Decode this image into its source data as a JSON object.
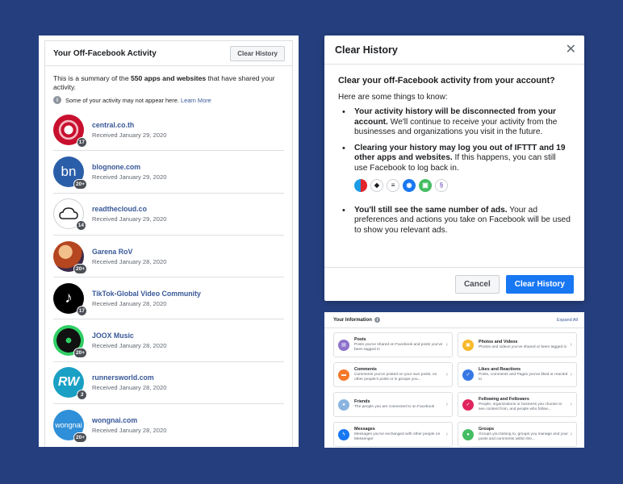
{
  "off_facebook": {
    "title": "Your Off-Facebook Activity",
    "clear_button": "Clear History",
    "summary_prefix": "This is a summary of the ",
    "summary_bold": "550 apps and websites",
    "summary_suffix": " that have shared your activity.",
    "note": "Some of your activity may not appear here.",
    "learn_more": "Learn More",
    "apps": [
      {
        "name": "central.co.th",
        "date": "Received January 29, 2020",
        "badge": "17",
        "icon": "central-logo-icon",
        "color": "#c8102e"
      },
      {
        "name": "blognone.com",
        "date": "Received January 29, 2020",
        "badge": "20+",
        "icon": "blognone-logo-icon",
        "color": "#2a5ea8"
      },
      {
        "name": "readthecloud.co",
        "date": "Received January 29, 2020",
        "badge": "14",
        "icon": "cloud-logo-icon",
        "color": "#ffffff"
      },
      {
        "name": "Garena RoV",
        "date": "Received January 28, 2020",
        "badge": "20+",
        "icon": "game-logo-icon",
        "color": "#b5461f"
      },
      {
        "name": "TikTok-Global Video Community",
        "date": "Received January 28, 2020",
        "badge": "17",
        "icon": "tiktok-logo-icon",
        "color": "#000000"
      },
      {
        "name": "JOOX Music",
        "date": "Received January 28, 2020",
        "badge": "20+",
        "icon": "joox-logo-icon",
        "color": "#2fce65"
      },
      {
        "name": "runnersworld.com",
        "date": "Received January 28, 2020",
        "badge": "3",
        "icon": "rw-logo-icon",
        "color": "#1aa0c4"
      },
      {
        "name": "wongnai.com",
        "date": "Received January 28, 2020",
        "badge": "20+",
        "icon": "wongnai-logo-icon",
        "color": "#2f8fd8"
      }
    ]
  },
  "dialog": {
    "title": "Clear History",
    "heading": "Clear your off-Facebook activity from your account?",
    "intro": "Here are some things to know:",
    "bullet1_bold": "Your activity history will be disconnected from your account.",
    "bullet1_text": " We'll continue to receive your activity from the businesses and organizations you visit in the future.",
    "bullet2_bold": "Clearing your history may log you out of IFTTT and 19 other apps and websites.",
    "bullet2_text": " If this happens, you can still use Facebook to log back in.",
    "bullet3_bold": "You'll still see the same number of ads.",
    "bullet3_text": " Your ad preferences and actions you take on Facebook will be used to show you relevant ads.",
    "cancel": "Cancel",
    "confirm": "Clear History",
    "accent_color": "#1877f2"
  },
  "your_information": {
    "title": "Your Information",
    "expand": "Expand All",
    "items": [
      {
        "name": "Posts",
        "desc": "Posts you've shared on Facebook and posts you've been tagged in",
        "icon": "posts-icon",
        "color": "#8c72cb"
      },
      {
        "name": "Photos and Videos",
        "desc": "Photos and videos you've shared or been tagged in",
        "icon": "photos-icon",
        "color": "#f7b928"
      },
      {
        "name": "Comments",
        "desc": "Comments you've posted on your own posts, on other people's posts or in groups you...",
        "icon": "comments-icon",
        "color": "#f5792b"
      },
      {
        "name": "Likes and Reactions",
        "desc": "Posts, comments and Pages you've liked or reacted to",
        "icon": "like-icon",
        "color": "#3578e5"
      },
      {
        "name": "Friends",
        "desc": "The people you are connected to on Facebook",
        "icon": "friends-icon",
        "color": "#8ab4e0"
      },
      {
        "name": "Following and Followers",
        "desc": "People, organizations or business you choose to see content from, and people who follow...",
        "icon": "following-icon",
        "color": "#e0245e"
      },
      {
        "name": "Messages",
        "desc": "Messages you've exchanged with other people on Messenger",
        "icon": "messenger-icon",
        "color": "#1877f2"
      },
      {
        "name": "Groups",
        "desc": "Groups you belong to, groups you manage and your posts and comments within the...",
        "icon": "groups-icon",
        "color": "#45bd62"
      }
    ]
  }
}
